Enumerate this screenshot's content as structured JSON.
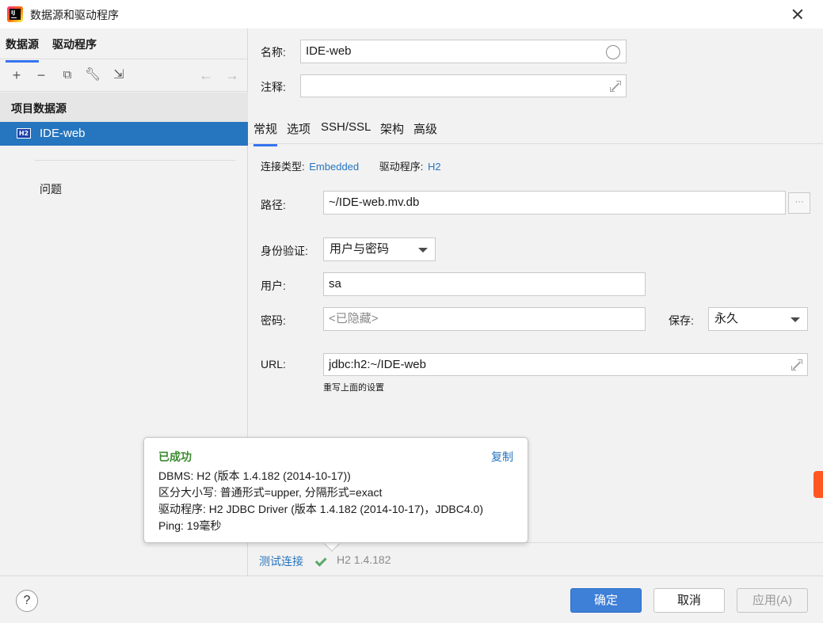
{
  "window": {
    "title": "数据源和驱动程序"
  },
  "left": {
    "tabs": [
      "数据源",
      "驱动程序"
    ],
    "section_title": "项目数据源",
    "datasource": {
      "badge": "H2",
      "label": "IDE-web"
    },
    "problems_label": "问题"
  },
  "form": {
    "name_label": "名称:",
    "name_value": "IDE-web",
    "comment_label": "注释:",
    "comment_value": "",
    "tabs": [
      "常规",
      "选项",
      "SSH/SSL",
      "架构",
      "高级"
    ],
    "conn_type_label": "连接类型:",
    "conn_type_value": "Embedded",
    "driver_label": "驱动程序:",
    "driver_value": "H2",
    "path_label": "路径:",
    "path_value": "~/IDE-web.mv.db",
    "dots": "···",
    "auth_label": "身份验证:",
    "auth_value": "用户与密码",
    "user_label": "用户:",
    "user_value": "sa",
    "password_label": "密码:",
    "password_placeholder": "<已隐藏>",
    "save_label": "保存:",
    "save_value": "永久",
    "url_label": "URL:",
    "url_value": "jdbc:h2:~/IDE-web",
    "url_note": "重写上面的设置"
  },
  "popup": {
    "status": "已成功",
    "copy": "复制",
    "lines": [
      "DBMS: H2 (版本 1.4.182 (2014-10-17))",
      "区分大小写: 普通形式=upper, 分隔形式=exact",
      "驱动程序: H2 JDBC Driver (版本 1.4.182 (2014-10-17)，JDBC4.0)",
      "Ping: 19毫秒"
    ]
  },
  "test": {
    "link": "测试连接",
    "driver_version": "H2 1.4.182"
  },
  "footer": {
    "help": "?",
    "ok": "确定",
    "cancel": "取消",
    "apply": "应用(A)"
  },
  "colors": {
    "accent": "#2675bf",
    "primary_button": "#3e7fd8",
    "success": "#3a8a2f",
    "selected_row": "#2675bf"
  }
}
